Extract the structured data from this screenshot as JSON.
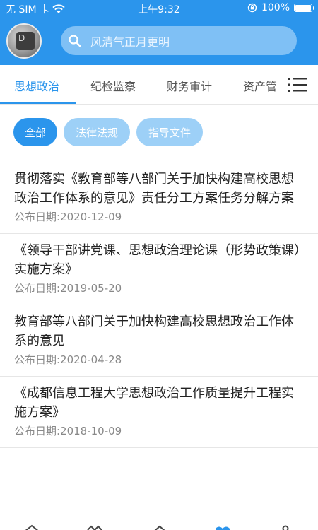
{
  "status_bar": {
    "carrier": "无 SIM 卡",
    "time": "上午9:32",
    "battery_percent": "100%",
    "battery_level": 1.0
  },
  "header": {
    "search_placeholder": "风清气正月更明"
  },
  "tabs": [
    {
      "label": "思想政治",
      "active": true
    },
    {
      "label": "纪检监察",
      "active": false
    },
    {
      "label": "财务审计",
      "active": false
    },
    {
      "label": "资产管",
      "active": false
    }
  ],
  "filters": [
    {
      "label": "全部",
      "active": true
    },
    {
      "label": "法律法规",
      "active": false
    },
    {
      "label": "指导文件",
      "active": false
    }
  ],
  "articles": [
    {
      "title": "贯彻落实《教育部等八部门关于加快构建高校思想政治工作体系的意见》责任分工方案任务分解方案",
      "date": "公布日期:2020-12-09"
    },
    {
      "title": "《领导干部讲党课、思想政治理论课（形势政策课）实施方案》",
      "date": "公布日期:2019-05-20"
    },
    {
      "title": "教育部等八部门关于加快构建高校思想政治工作体系的意见",
      "date": "公布日期:2020-04-28"
    },
    {
      "title": "《成都信息工程大学思想政治工作质量提升工程实施方案》",
      "date": "公布日期:2018-10-09"
    }
  ],
  "colors": {
    "primary": "#2b95ec",
    "pill_inactive": "#9dd0f7",
    "search_bg": "#7fc0f5"
  }
}
